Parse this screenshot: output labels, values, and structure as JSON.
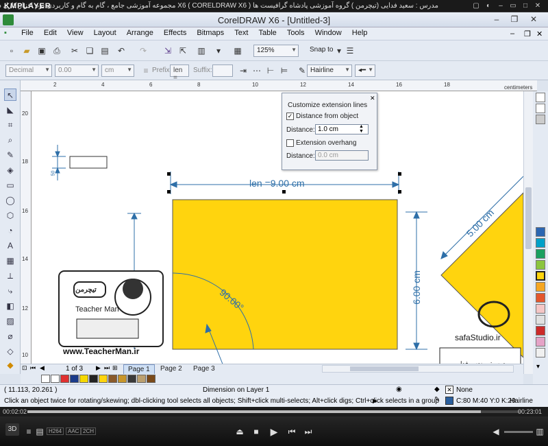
{
  "player": {
    "logo": "KMPLAYER",
    "caption": "مجموعه آموزشی جامع ، گام به گام و کاربردی نرم افزار کارل درا و X6 ( CORELDRAW X6 )   مدرس : سعید فدایی (تیچرمن ) گروه آموزشی پادشاه گرافیست ها",
    "time_current": "00:02:02",
    "time_total": "00:23:01",
    "progress": 0.92,
    "badges": [
      "H264",
      "AAC",
      "2CH"
    ],
    "mode_label": "3D"
  },
  "app": {
    "title": "CorelDRAW X6 - [Untitled-3]",
    "menu": [
      "File",
      "Edit",
      "View",
      "Layout",
      "Arrange",
      "Effects",
      "Bitmaps",
      "Text",
      "Table",
      "Tools",
      "Window",
      "Help"
    ]
  },
  "toolbar": {
    "zoom": "125%",
    "snap_to": "Snap to"
  },
  "propbar": {
    "style": "Decimal",
    "precision": "0.00",
    "units": "cm",
    "prefix_label": "Prefix:",
    "prefix_value": "len =",
    "suffix_label": "Suffix:",
    "outline": "Hairline"
  },
  "ruler": {
    "units": "centimeters",
    "h_ticks": [
      "2",
      "4",
      "6",
      "8",
      "10",
      "12",
      "14",
      "16",
      "18"
    ],
    "v_ticks": [
      "20",
      "18",
      "16",
      "14",
      "12",
      "10"
    ],
    "v_units": "centimeters"
  },
  "dialog": {
    "title": "Customize extension lines",
    "distance_from_object": "Distance from object",
    "distance_label": "Distance:",
    "distance_value": "1.0 cm",
    "extension_overhang": "Extension overhang",
    "distance2_label": "Distance:",
    "distance2_value": "0.0 cm"
  },
  "drawing": {
    "top_dim": "len =9.00 cm",
    "small_dim": "50",
    "right_dim": "6.00 cm",
    "angle_dim": "90.00°",
    "diag_dim": "5.00 cm",
    "teacher_url": "www.TeacherMan.ir",
    "teacher_name": "Teacher Man",
    "teacher_logo": "تیچرمن",
    "safa_url": "safaStudio.ir",
    "safa_caption": "مدرس: مهندس فدایی"
  },
  "pages": {
    "counter": "1 of 3",
    "tabs": [
      "Page 1",
      "Page 2",
      "Page 3"
    ]
  },
  "status": {
    "coords": "( 11.113, 20.261 )",
    "layer": "Dimension on Layer 1",
    "hint": "Click an object twice for rotating/skewing; dbl-clicking tool selects all objects; Shift+click multi-selects; Alt+click digs; Ctrl+click selects in a group",
    "fill_label": "None",
    "outline_color": "C:80 M:40 Y:0 K:20",
    "outline_width": "Hairline"
  },
  "colors": {
    "rect_fill": "#FFD40E",
    "dimension": "#2E6FA8",
    "outline_swatch": "#2A5F9E"
  }
}
